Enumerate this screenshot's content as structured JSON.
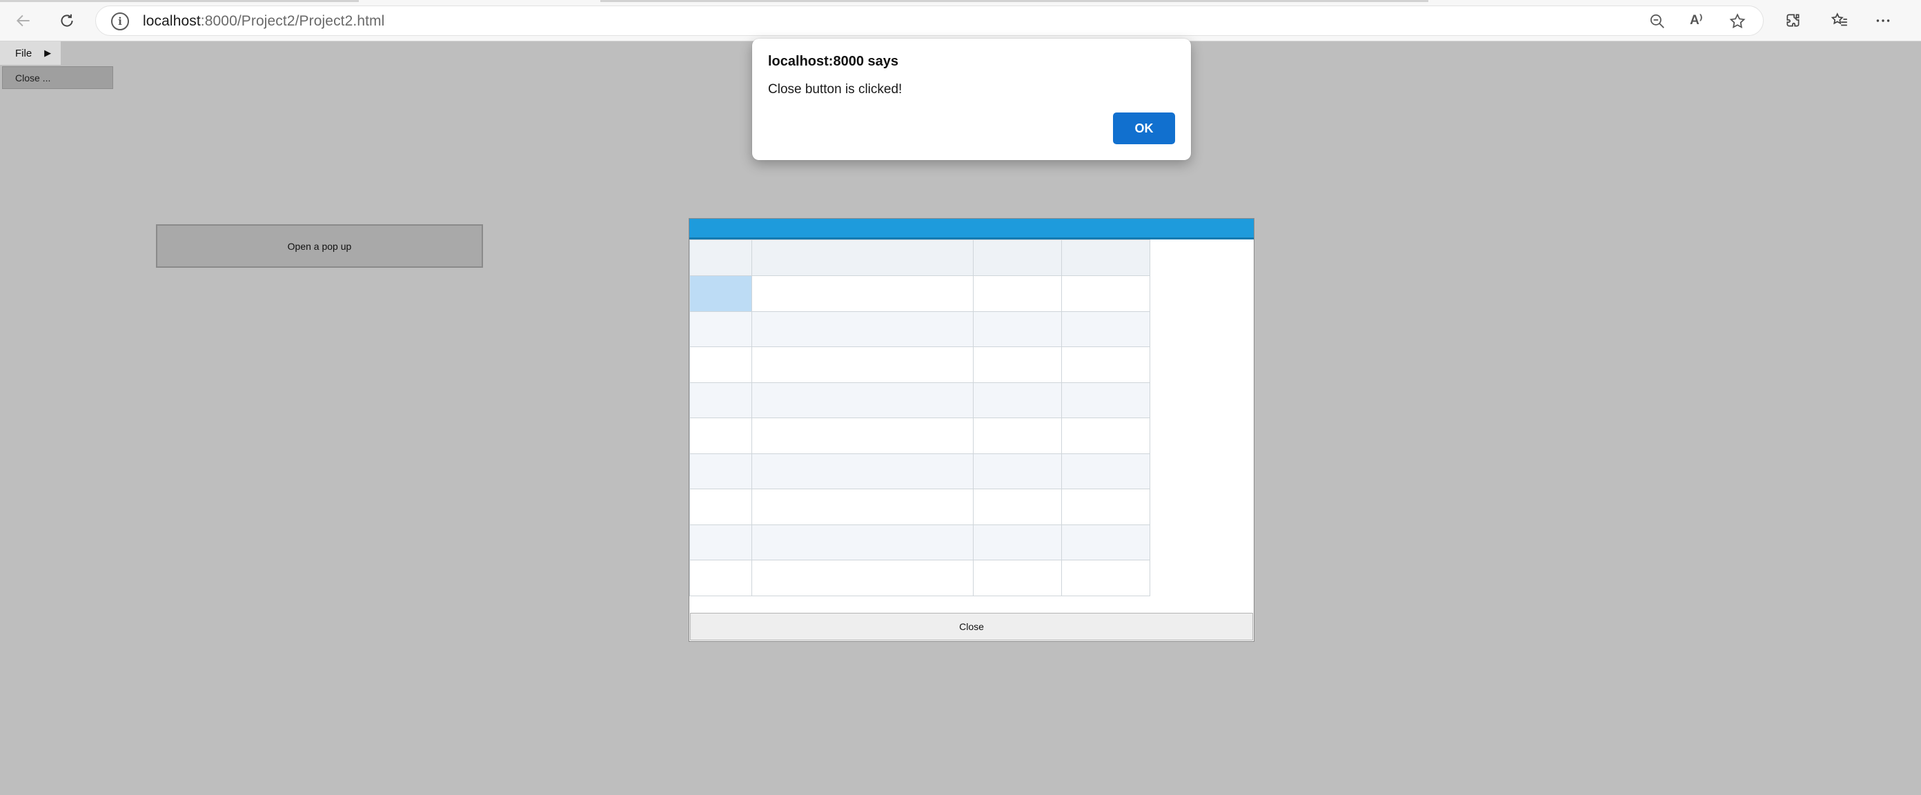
{
  "browser": {
    "url_host": "localhost",
    "url_rest": ":8000/Project2/Project2.html",
    "icons": [
      "back-arrow-icon",
      "refresh-icon",
      "info-icon",
      "zoom-out-icon",
      "read-aloud-icon",
      "favorite-star-icon",
      "extensions-icon",
      "favorites-icon",
      "more-icon"
    ],
    "read_aloud_glyph": "A⁾"
  },
  "page": {
    "file_menu_label": "File",
    "file_menu_arrow": "▶",
    "close_menu_item": "Close ...",
    "open_popup_label": "Open a pop up"
  },
  "popup": {
    "header_color": "#1e9bdc",
    "close_label": "Close",
    "selected_cell_color": "#bddcf5"
  },
  "alert": {
    "title": "localhost:8000 says",
    "message": "Close button is clicked!",
    "ok_label": "OK",
    "ok_color": "#1170cf"
  }
}
